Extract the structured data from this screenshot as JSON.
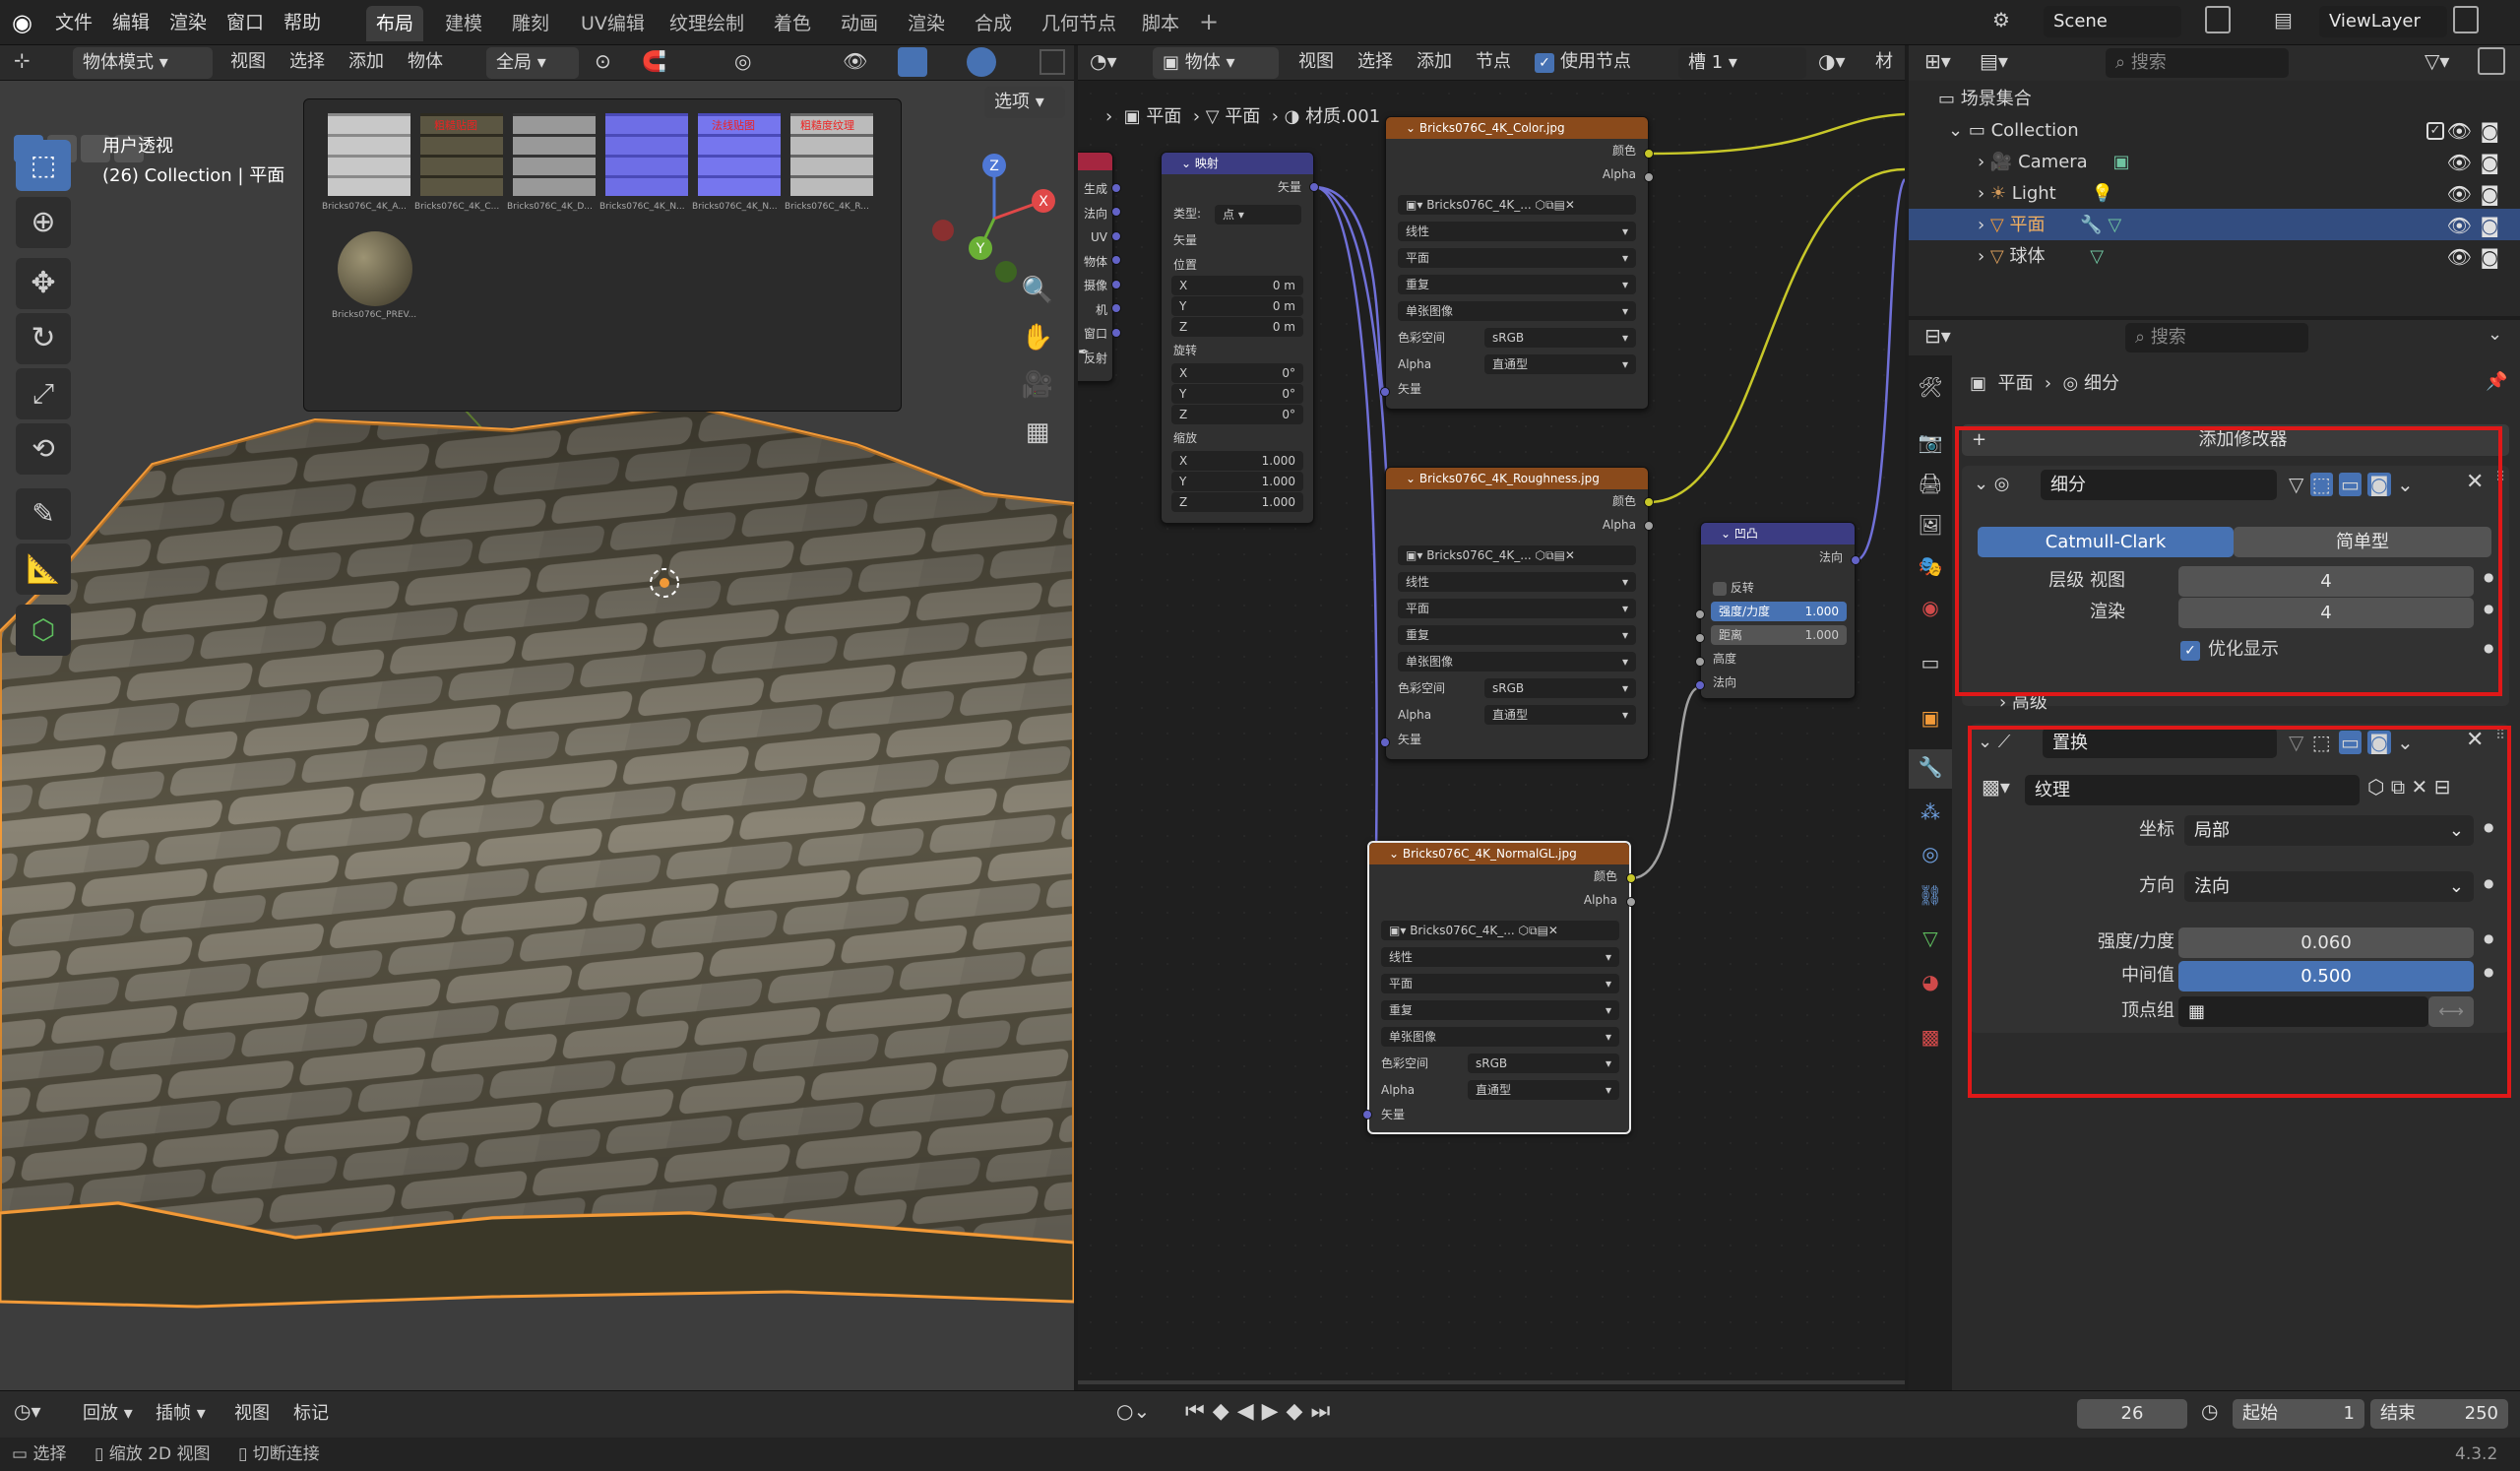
{
  "menu": {
    "file": "文件",
    "edit": "编辑",
    "render": "渲染",
    "window": "窗口",
    "help": "帮助"
  },
  "workspaces": [
    "布局",
    "建模",
    "雕刻",
    "UV编辑",
    "纹理绘制",
    "着色",
    "动画",
    "渲染",
    "合成",
    "几何节点",
    "脚本"
  ],
  "scene": {
    "label": "Scene",
    "viewlayer": "ViewLayer"
  },
  "viewport": {
    "mode": "物体模式",
    "menus": [
      "视图",
      "选择",
      "添加",
      "物体"
    ],
    "transform": "全局",
    "options": "选项",
    "overlay_title": "用户透视",
    "overlay_sub": "(26) Collection | 平面",
    "thumbs": [
      "Bricks076C_4K_A...",
      "Bricks076C_4K_C...",
      "Bricks076C_4K_D...",
      "Bricks076C_4K_N...",
      "Bricks076C_4K_N...",
      "Bricks076C_4K_R...",
      "Bricks076C_PREV..."
    ],
    "thumb_labels": [
      "粗糙贴图",
      "法线贴图",
      "粗糙度纹理"
    ],
    "gizmo": {
      "x": "X",
      "y": "Y",
      "z": "Z"
    }
  },
  "node_editor": {
    "type": "物体",
    "menus": [
      "视图",
      "选择",
      "添加",
      "节点"
    ],
    "use_nodes": "使用节点",
    "slot": "槽 1",
    "material_cut": "材",
    "breadcrumb": [
      "平面",
      "平面",
      "材质.001"
    ],
    "texcoord": {
      "outputs": [
        "生成",
        "法向",
        "UV",
        "物体",
        "摄像机",
        "窗口",
        "反射"
      ]
    },
    "mapping": {
      "title": "映射",
      "out": "矢量",
      "type_label": "类型:",
      "type_val": "点",
      "vector": "矢量",
      "loc": "位置",
      "rot": "旋转",
      "scale": "缩放",
      "loc_vals": [
        "0 m",
        "0 m",
        "0 m"
      ],
      "rot_vals": [
        "0°",
        "0°",
        "0°"
      ],
      "scale_vals": [
        "1.000",
        "1.000",
        "1.000"
      ],
      "axes": [
        "X",
        "Y",
        "Z"
      ]
    },
    "tex_color": {
      "title": "Bricks076C_4K_Color.jpg",
      "img": "Bricks076C_4K_...",
      "color": "颜色",
      "alpha": "Alpha",
      "interp": "线性",
      "proj": "平面",
      "ext": "重复",
      "src": "单张图像",
      "cs_label": "色彩空间",
      "cs": "sRGB",
      "alpha_label": "Alpha",
      "alpha_mode": "直通型",
      "vector": "矢量"
    },
    "tex_rough": {
      "title": "Bricks076C_4K_Roughness.jpg",
      "img": "Bricks076C_4K_...",
      "color": "颜色",
      "alpha": "Alpha",
      "interp": "线性",
      "proj": "平面",
      "ext": "重复",
      "src": "单张图像",
      "cs_label": "色彩空间",
      "cs": "sRGB",
      "alpha_label": "Alpha",
      "alpha_mode": "直通型",
      "vector": "矢量"
    },
    "tex_normal": {
      "title": "Bricks076C_4K_NormalGL.jpg",
      "img": "Bricks076C_4K_...",
      "color": "颜色",
      "alpha": "Alpha",
      "interp": "线性",
      "proj": "平面",
      "ext": "重复",
      "src": "单张图像",
      "cs_label": "色彩空间",
      "cs": "sRGB",
      "alpha_label": "Alpha",
      "alpha_mode": "直通型",
      "vector": "矢量"
    },
    "bump": {
      "title": "凹凸",
      "out": "法向",
      "invert": "反转",
      "strength": "强度/力度",
      "strength_val": "1.000",
      "distance": "距离",
      "distance_val": "1.000",
      "height": "高度",
      "normal": "法向"
    }
  },
  "outliner": {
    "search": "搜索",
    "root": "场景集合",
    "collection": "Collection",
    "items": [
      {
        "name": "Camera"
      },
      {
        "name": "Light"
      },
      {
        "name": "平面"
      },
      {
        "name": "球体"
      }
    ]
  },
  "properties": {
    "search": "搜索",
    "crumb_obj": "平面",
    "crumb_mod": "细分",
    "add_modifier": "添加修改器",
    "subsurf": {
      "name": "细分",
      "mode_a": "Catmull-Clark",
      "mode_b": "简单型",
      "levels_label": "层级 视图",
      "levels": "4",
      "render_label": "渲染",
      "render": "4",
      "optimal": "优化显示",
      "advanced": "高级"
    },
    "displace": {
      "name": "置换",
      "texture": "纹理",
      "coord_label": "坐标",
      "coord": "局部",
      "dir_label": "方向",
      "dir": "法向",
      "strength_label": "强度/力度",
      "strength": "0.060",
      "mid_label": "中间值",
      "mid": "0.500",
      "vgroup_label": "顶点组"
    }
  },
  "timeline": {
    "playback": "回放",
    "keying": "插帧",
    "view": "视图",
    "marker": "标记",
    "frame": "26",
    "start_label": "起始",
    "start": "1",
    "end_label": "结束",
    "end": "250"
  },
  "status": {
    "select": "选择",
    "zoom": "缩放 2D 视图",
    "cut": "切断连接",
    "version": "4.3.2"
  },
  "colors": {
    "accent": "#4772b3",
    "highlight": "#334d80",
    "outline_orange": "#f29a38",
    "redbox": "#e01818"
  }
}
